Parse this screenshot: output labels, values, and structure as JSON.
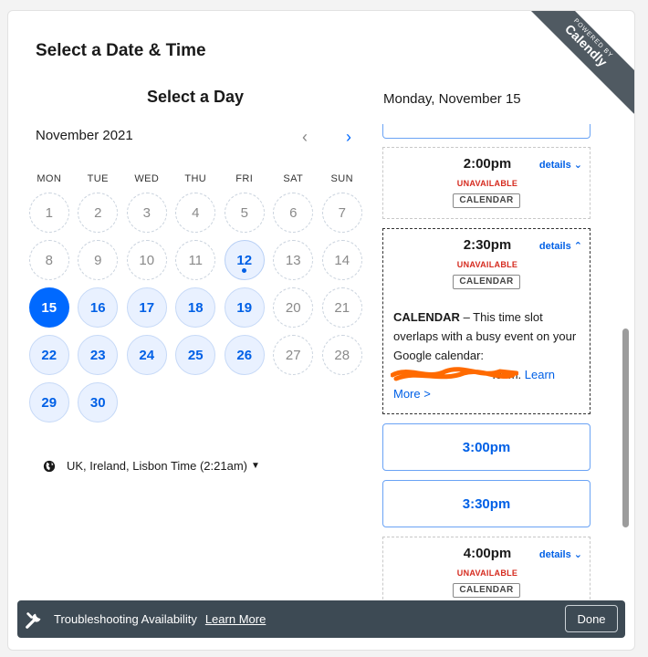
{
  "header": {
    "title": "Select a Date & Time"
  },
  "badge": {
    "powered_by": "POWERED BY",
    "brand": "Calendly"
  },
  "calendar": {
    "heading": "Select a Day",
    "month": "November 2021",
    "prev_icon": "chevron-left-icon",
    "next_icon": "chevron-right-icon",
    "weekdays": [
      "MON",
      "TUE",
      "WED",
      "THU",
      "FRI",
      "SAT",
      "SUN"
    ],
    "days": [
      {
        "n": "1",
        "s": "off"
      },
      {
        "n": "2",
        "s": "off"
      },
      {
        "n": "3",
        "s": "off"
      },
      {
        "n": "4",
        "s": "off"
      },
      {
        "n": "5",
        "s": "off"
      },
      {
        "n": "6",
        "s": "off"
      },
      {
        "n": "7",
        "s": "off"
      },
      {
        "n": "8",
        "s": "off"
      },
      {
        "n": "9",
        "s": "off"
      },
      {
        "n": "10",
        "s": "off"
      },
      {
        "n": "11",
        "s": "off"
      },
      {
        "n": "12",
        "s": "today"
      },
      {
        "n": "13",
        "s": "off"
      },
      {
        "n": "14",
        "s": "off"
      },
      {
        "n": "15",
        "s": "selected"
      },
      {
        "n": "16",
        "s": "avail"
      },
      {
        "n": "17",
        "s": "avail"
      },
      {
        "n": "18",
        "s": "avail"
      },
      {
        "n": "19",
        "s": "avail"
      },
      {
        "n": "20",
        "s": "off"
      },
      {
        "n": "21",
        "s": "off"
      },
      {
        "n": "22",
        "s": "avail"
      },
      {
        "n": "23",
        "s": "avail"
      },
      {
        "n": "24",
        "s": "avail"
      },
      {
        "n": "25",
        "s": "avail"
      },
      {
        "n": "26",
        "s": "avail"
      },
      {
        "n": "27",
        "s": "off"
      },
      {
        "n": "28",
        "s": "off"
      },
      {
        "n": "29",
        "s": "avail"
      },
      {
        "n": "30",
        "s": "avail"
      }
    ]
  },
  "timezone": {
    "label": "UK, Ireland, Lisbon Time (2:21am)",
    "icon": "globe-icon"
  },
  "slots_panel": {
    "date": "Monday, November 15",
    "slots": [
      {
        "type": "partial"
      },
      {
        "type": "unavail",
        "time": "2:00pm",
        "details": "details ⌄",
        "status": "UNAVAILABLE",
        "tag": "CALENDAR"
      },
      {
        "type": "expanded",
        "time": "2:30pm",
        "details": "details ⌃",
        "status": "UNAVAILABLE",
        "tag": "CALENDAR",
        "desc_bold": "CALENDAR",
        "desc_text": " – This time slot overlaps with a busy event on your Google calendar:",
        "desc_tail": ".com.",
        "link": "Learn More >"
      },
      {
        "type": "open",
        "time": "3:00pm"
      },
      {
        "type": "open",
        "time": "3:30pm"
      },
      {
        "type": "unavail",
        "time": "4:00pm",
        "details": "details ⌄",
        "status": "UNAVAILABLE",
        "tag": "CALENDAR"
      }
    ]
  },
  "footer": {
    "label": "Troubleshooting Availability",
    "learn_more": "Learn More",
    "done": "Done",
    "icon": "wrench-icon"
  },
  "colors": {
    "accent": "#0069ff",
    "unavailable": "#d52a1e",
    "footer_bg": "#3d4a54"
  }
}
